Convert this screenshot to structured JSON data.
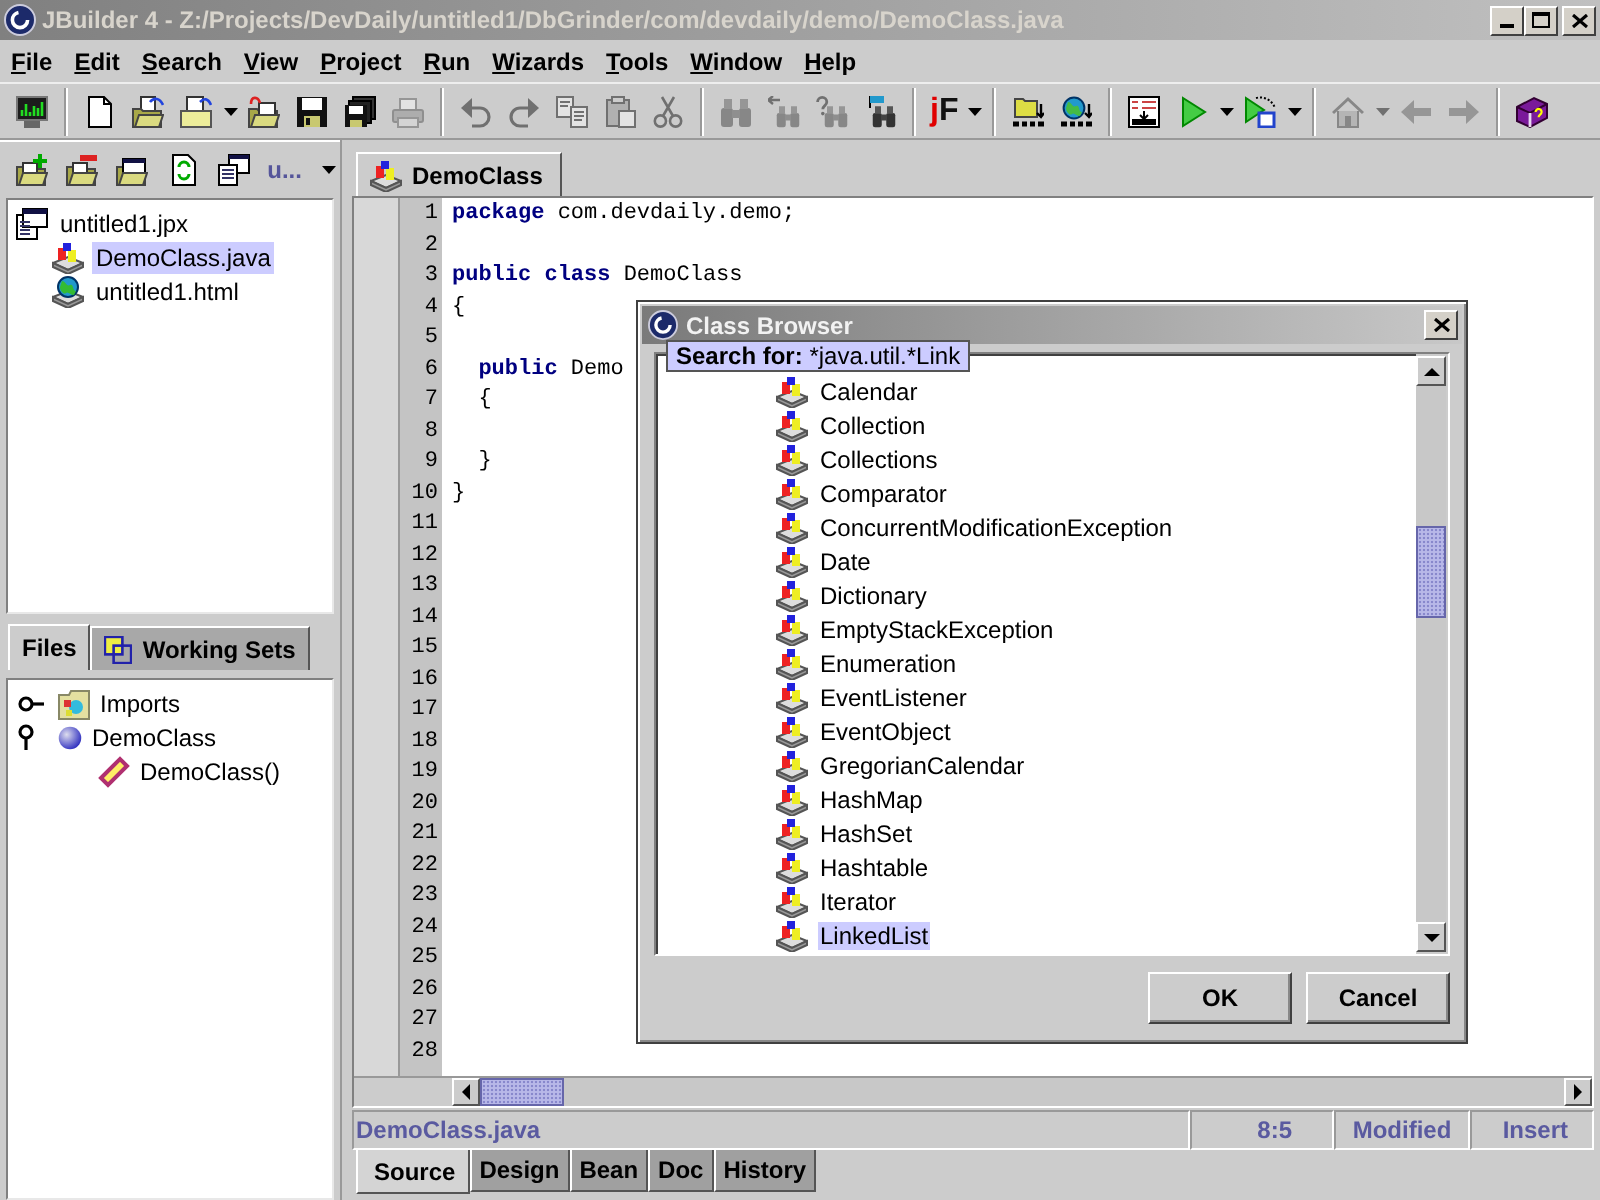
{
  "window": {
    "title": "JBuilder 4 - Z:/Projects/DevDaily/untitled1/DbGrinder/com/devdaily/demo/DemoClass.java"
  },
  "menu": [
    "File",
    "Edit",
    "Search",
    "View",
    "Project",
    "Run",
    "Wizards",
    "Tools",
    "Window",
    "Help"
  ],
  "toolbar": {
    "groups": [
      [
        {
          "kind": "monitor",
          "disabled": false,
          "dropdown": false
        }
      ],
      [
        {
          "kind": "newfile",
          "disabled": false,
          "dropdown": false
        },
        {
          "kind": "openproject",
          "disabled": false,
          "dropdown": false
        },
        {
          "kind": "openfile",
          "disabled": false,
          "dropdown": true
        },
        {
          "kind": "reopen",
          "disabled": false,
          "dropdown": false
        },
        {
          "kind": "save",
          "disabled": false,
          "dropdown": false
        },
        {
          "kind": "saveall",
          "disabled": false,
          "dropdown": false
        },
        {
          "kind": "print",
          "disabled": true,
          "dropdown": false
        }
      ],
      [
        {
          "kind": "undo",
          "disabled": true,
          "dropdown": false
        },
        {
          "kind": "redo",
          "disabled": true,
          "dropdown": false
        },
        {
          "kind": "copy",
          "disabled": true,
          "dropdown": false
        },
        {
          "kind": "paste",
          "disabled": true,
          "dropdown": false
        },
        {
          "kind": "cut",
          "disabled": true,
          "dropdown": false
        }
      ],
      [
        {
          "kind": "find",
          "disabled": true,
          "dropdown": false
        },
        {
          "kind": "findnext",
          "disabled": true,
          "dropdown": false
        },
        {
          "kind": "findquery",
          "disabled": true,
          "dropdown": false
        },
        {
          "kind": "findflag",
          "disabled": false,
          "dropdown": false
        }
      ],
      [
        {
          "kind": "text",
          "label": "jF",
          "disabled": false,
          "dropdown": true
        }
      ],
      [
        {
          "kind": "make",
          "disabled": false,
          "dropdown": false
        },
        {
          "kind": "rebuild",
          "disabled": false,
          "dropdown": false
        }
      ],
      [
        {
          "kind": "form",
          "disabled": false,
          "dropdown": false
        },
        {
          "kind": "run",
          "disabled": false,
          "dropdown": true
        },
        {
          "kind": "debug",
          "disabled": false,
          "dropdown": true
        }
      ],
      [
        {
          "kind": "home",
          "disabled": true,
          "dropdown": true
        },
        {
          "kind": "back",
          "disabled": true,
          "dropdown": false
        },
        {
          "kind": "forward",
          "disabled": true,
          "dropdown": false
        }
      ],
      [
        {
          "kind": "help",
          "disabled": false,
          "dropdown": false
        }
      ]
    ]
  },
  "project_panel": {
    "toolbar": [
      {
        "kind": "addfolder"
      },
      {
        "kind": "removefolder"
      },
      {
        "kind": "closeproject"
      },
      {
        "kind": "refresh"
      },
      {
        "kind": "windows"
      }
    ],
    "selector": "u...",
    "tree": [
      {
        "label": "untitled1.jpx",
        "kind": "project",
        "selected": false,
        "children": [
          {
            "label": "DemoClass.java",
            "kind": "source",
            "selected": true
          },
          {
            "label": "untitled1.html",
            "kind": "html",
            "selected": false
          }
        ]
      }
    ],
    "tabs": [
      {
        "label": "Files",
        "kind": "plain",
        "selected": true
      },
      {
        "label": "Working Sets",
        "kind": "sets",
        "selected": false
      }
    ]
  },
  "structure": {
    "tree": [
      {
        "label": "Imports",
        "kind": "imports",
        "expanded": false
      },
      {
        "label": "DemoClass",
        "kind": "class",
        "expanded": true,
        "children": [
          {
            "label": "DemoClass()",
            "kind": "method"
          }
        ]
      }
    ]
  },
  "editor": {
    "tabs": [
      {
        "label": "DemoClass",
        "selected": true
      }
    ],
    "lines": [
      {
        "number": "1",
        "text": "**package** com.devdaily.demo;"
      },
      {
        "number": "2"
      },
      {
        "number": "3",
        "text": "**public** **class** DemoClass"
      },
      {
        "number": "4",
        "text": "{"
      },
      {
        "number": "5"
      },
      {
        "number": "6",
        "text": "  **public** Demo"
      },
      {
        "number": "7",
        "text": "  {"
      },
      {
        "number": "8"
      },
      {
        "number": "9",
        "text": "  }"
      },
      {
        "number": "10",
        "text": "}"
      },
      {
        "number": "11"
      },
      {
        "number": "12"
      },
      {
        "number": "13"
      },
      {
        "number": "14"
      },
      {
        "number": "15"
      },
      {
        "number": "16"
      },
      {
        "number": "17"
      },
      {
        "number": "18"
      },
      {
        "number": "19"
      },
      {
        "number": "20"
      },
      {
        "number": "21"
      },
      {
        "number": "22"
      },
      {
        "number": "23"
      },
      {
        "number": "24"
      },
      {
        "number": "25"
      },
      {
        "number": "26"
      },
      {
        "number": "27"
      },
      {
        "number": "28"
      }
    ]
  },
  "status_bar": {
    "file": "DemoClass.java",
    "position": "8:5",
    "state": "Modified",
    "mode": "Insert"
  },
  "view_tabs": [
    {
      "label": "Source",
      "selected": true
    },
    {
      "label": "Design",
      "selected": false
    },
    {
      "label": "Bean",
      "selected": false
    },
    {
      "label": "Doc",
      "selected": false
    },
    {
      "label": "History",
      "selected": false
    }
  ],
  "dialog": {
    "title": "Class Browser",
    "tooltip": "**Search for:** *java.util.*Link",
    "items": [
      {
        "label": "Calendar",
        "selected": false
      },
      {
        "label": "Collection",
        "selected": false
      },
      {
        "label": "Collections",
        "selected": false
      },
      {
        "label": "Comparator",
        "selected": false
      },
      {
        "label": "ConcurrentModificationException",
        "selected": false
      },
      {
        "label": "Date",
        "selected": false
      },
      {
        "label": "Dictionary",
        "selected": false
      },
      {
        "label": "EmptyStackException",
        "selected": false
      },
      {
        "label": "Enumeration",
        "selected": false
      },
      {
        "label": "EventListener",
        "selected": false
      },
      {
        "label": "EventObject",
        "selected": false
      },
      {
        "label": "GregorianCalendar",
        "selected": false
      },
      {
        "label": "HashMap",
        "selected": false
      },
      {
        "label": "HashSet",
        "selected": false
      },
      {
        "label": "Hashtable",
        "selected": false
      },
      {
        "label": "Iterator",
        "selected": false
      },
      {
        "label": "LinkedList",
        "selected": true
      }
    ],
    "buttons": [
      "OK",
      "Cancel"
    ]
  }
}
